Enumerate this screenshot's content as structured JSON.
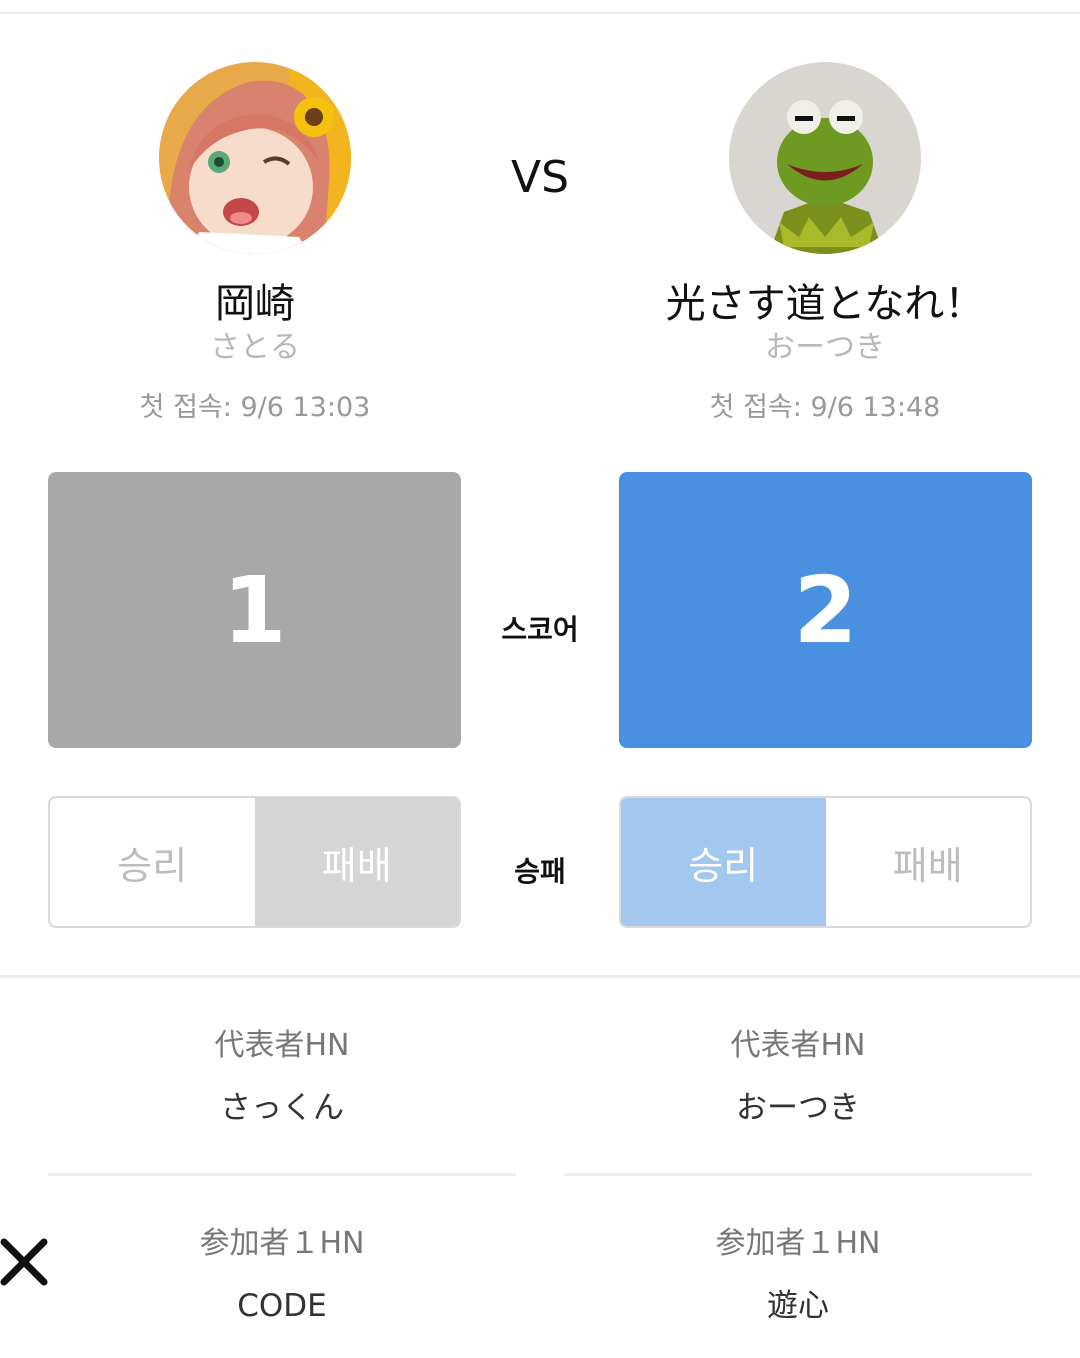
{
  "vs_label": "VS",
  "players": {
    "left": {
      "name": "岡崎",
      "sub": "さとる",
      "first_access": "첫 접속: 9/6 13:03",
      "score": "1",
      "win_label": "승리",
      "lose_label": "패배",
      "selected": "lose"
    },
    "right": {
      "name": "光さす道となれ！",
      "sub": "おーつき",
      "first_access": "첫 접속: 9/6 13:48",
      "score": "2",
      "win_label": "승리",
      "lose_label": "패배",
      "selected": "win"
    }
  },
  "labels": {
    "score": "스코어",
    "result": "승패"
  },
  "teams": {
    "left": {
      "rep_label": "代表者HN",
      "rep_value": "さっくん",
      "p1_label": "参加者１HN",
      "p1_value": "CODE"
    },
    "right": {
      "rep_label": "代表者HN",
      "rep_value": "おーつき",
      "p1_label": "参加者１HN",
      "p1_value": "遊心"
    }
  },
  "colors": {
    "left_score_bg": "#a8a8a8",
    "right_score_bg": "#4a90e0",
    "win_selected_bg": "#a3c8ef",
    "lose_selected_bg": "#d5d5d5"
  },
  "icons": {
    "close": "close-icon"
  }
}
